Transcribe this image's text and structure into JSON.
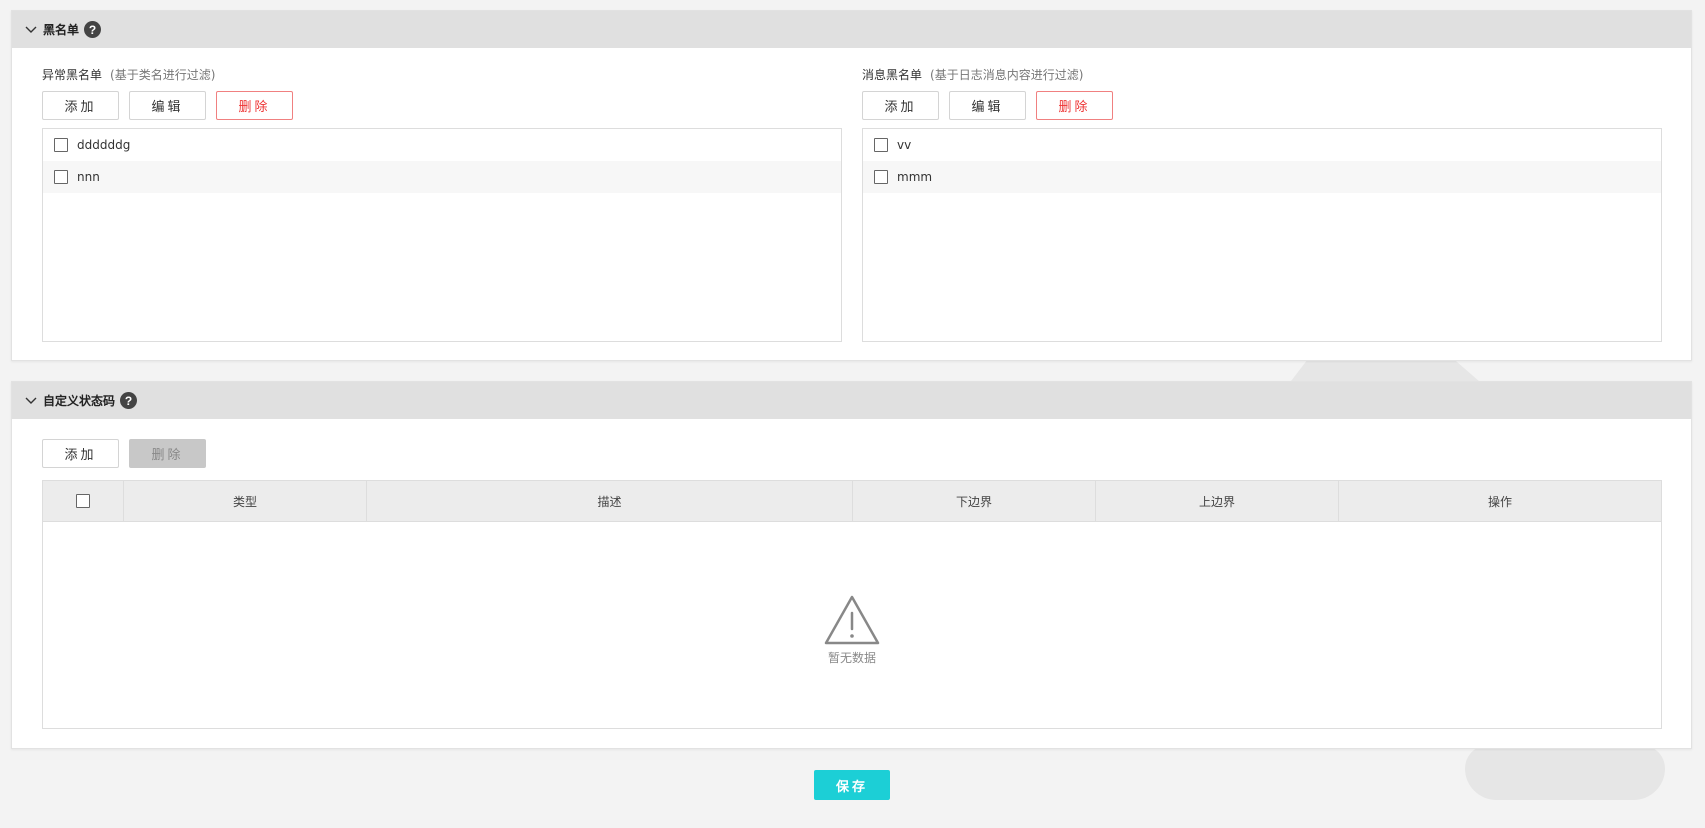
{
  "blacklist": {
    "title": "黑名单",
    "help": "?",
    "exception": {
      "label": "异常黑名单",
      "hint": "(基于类名进行过滤)",
      "add_label": "添加",
      "edit_label": "编辑",
      "delete_label": "删除",
      "items": [
        {
          "text": "ddddddg"
        },
        {
          "text": "nnn"
        }
      ]
    },
    "message": {
      "label": "消息黑名单",
      "hint": "(基于日志消息内容进行过滤)",
      "add_label": "添加",
      "edit_label": "编辑",
      "delete_label": "删除",
      "items": [
        {
          "text": "vv"
        },
        {
          "text": "mmm"
        }
      ]
    }
  },
  "status_codes": {
    "title": "自定义状态码",
    "help": "?",
    "add_label": "添加",
    "delete_label": "删除",
    "columns": [
      "类型",
      "描述",
      "下边界",
      "上边界",
      "操作"
    ],
    "empty_text": "暂无数据"
  },
  "save_label": "保存",
  "colors": {
    "accent": "#1ccfd6",
    "danger": "#e33333",
    "header_bg": "#e0e0e0"
  }
}
